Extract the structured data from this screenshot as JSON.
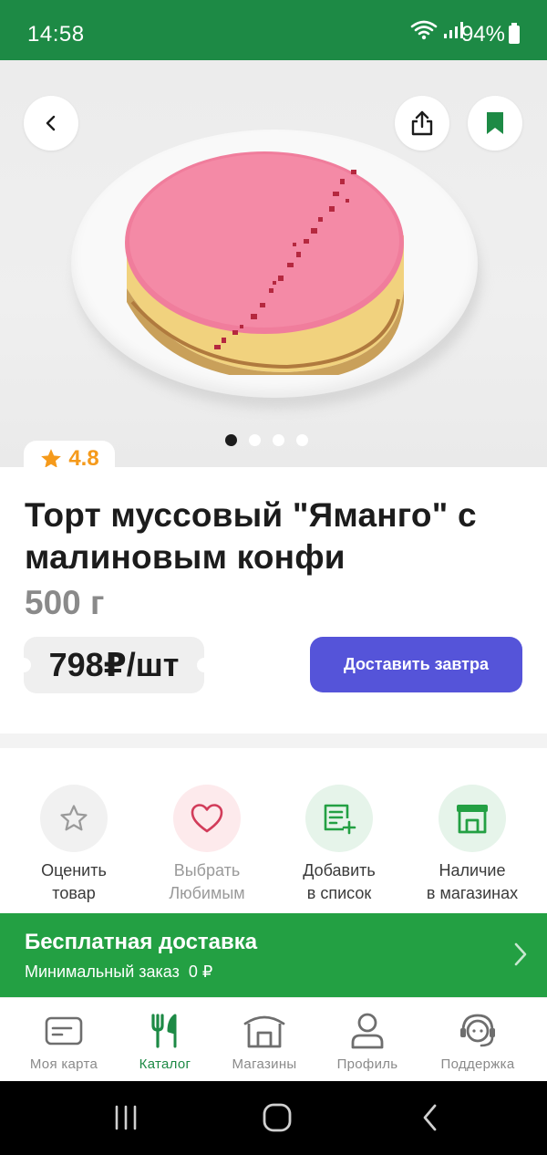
{
  "status_bar": {
    "time": "14:58",
    "battery": "94%"
  },
  "product": {
    "rating": "4.8",
    "title": "Торт муссовый \"Яманго\" с малиновым конфи",
    "weight": "500 г",
    "price": "798₽/шт",
    "deliver_label": "Доставить завтра",
    "gallery_total": 4,
    "gallery_active": 1
  },
  "actions": [
    {
      "line1": "Оценить",
      "line2": "товар",
      "icon": "star-icon"
    },
    {
      "line1": "Выбрать",
      "line2": "Любимым",
      "icon": "heart-icon"
    },
    {
      "line1": "Добавить",
      "line2": "в список",
      "icon": "add-to-list-icon"
    },
    {
      "line1": "Наличие",
      "line2": "в магазинах",
      "icon": "store-icon"
    }
  ],
  "banner": {
    "title": "Бесплатная доставка",
    "subtitle": "Минимальный заказ  0 ₽"
  },
  "bottom_nav": [
    {
      "label": "Моя карта",
      "icon": "card-icon",
      "active": false
    },
    {
      "label": "Каталог",
      "icon": "fork-knife-icon",
      "active": true
    },
    {
      "label": "Магазины",
      "icon": "store-icon",
      "active": false
    },
    {
      "label": "Профиль",
      "icon": "profile-icon",
      "active": false
    },
    {
      "label": "Поддержка",
      "icon": "support-icon",
      "active": false
    }
  ],
  "colors": {
    "brand_green": "#1d8a45",
    "banner_green": "#23a043",
    "accent_purple": "#5554d9",
    "rating_orange": "#f59a1b"
  }
}
